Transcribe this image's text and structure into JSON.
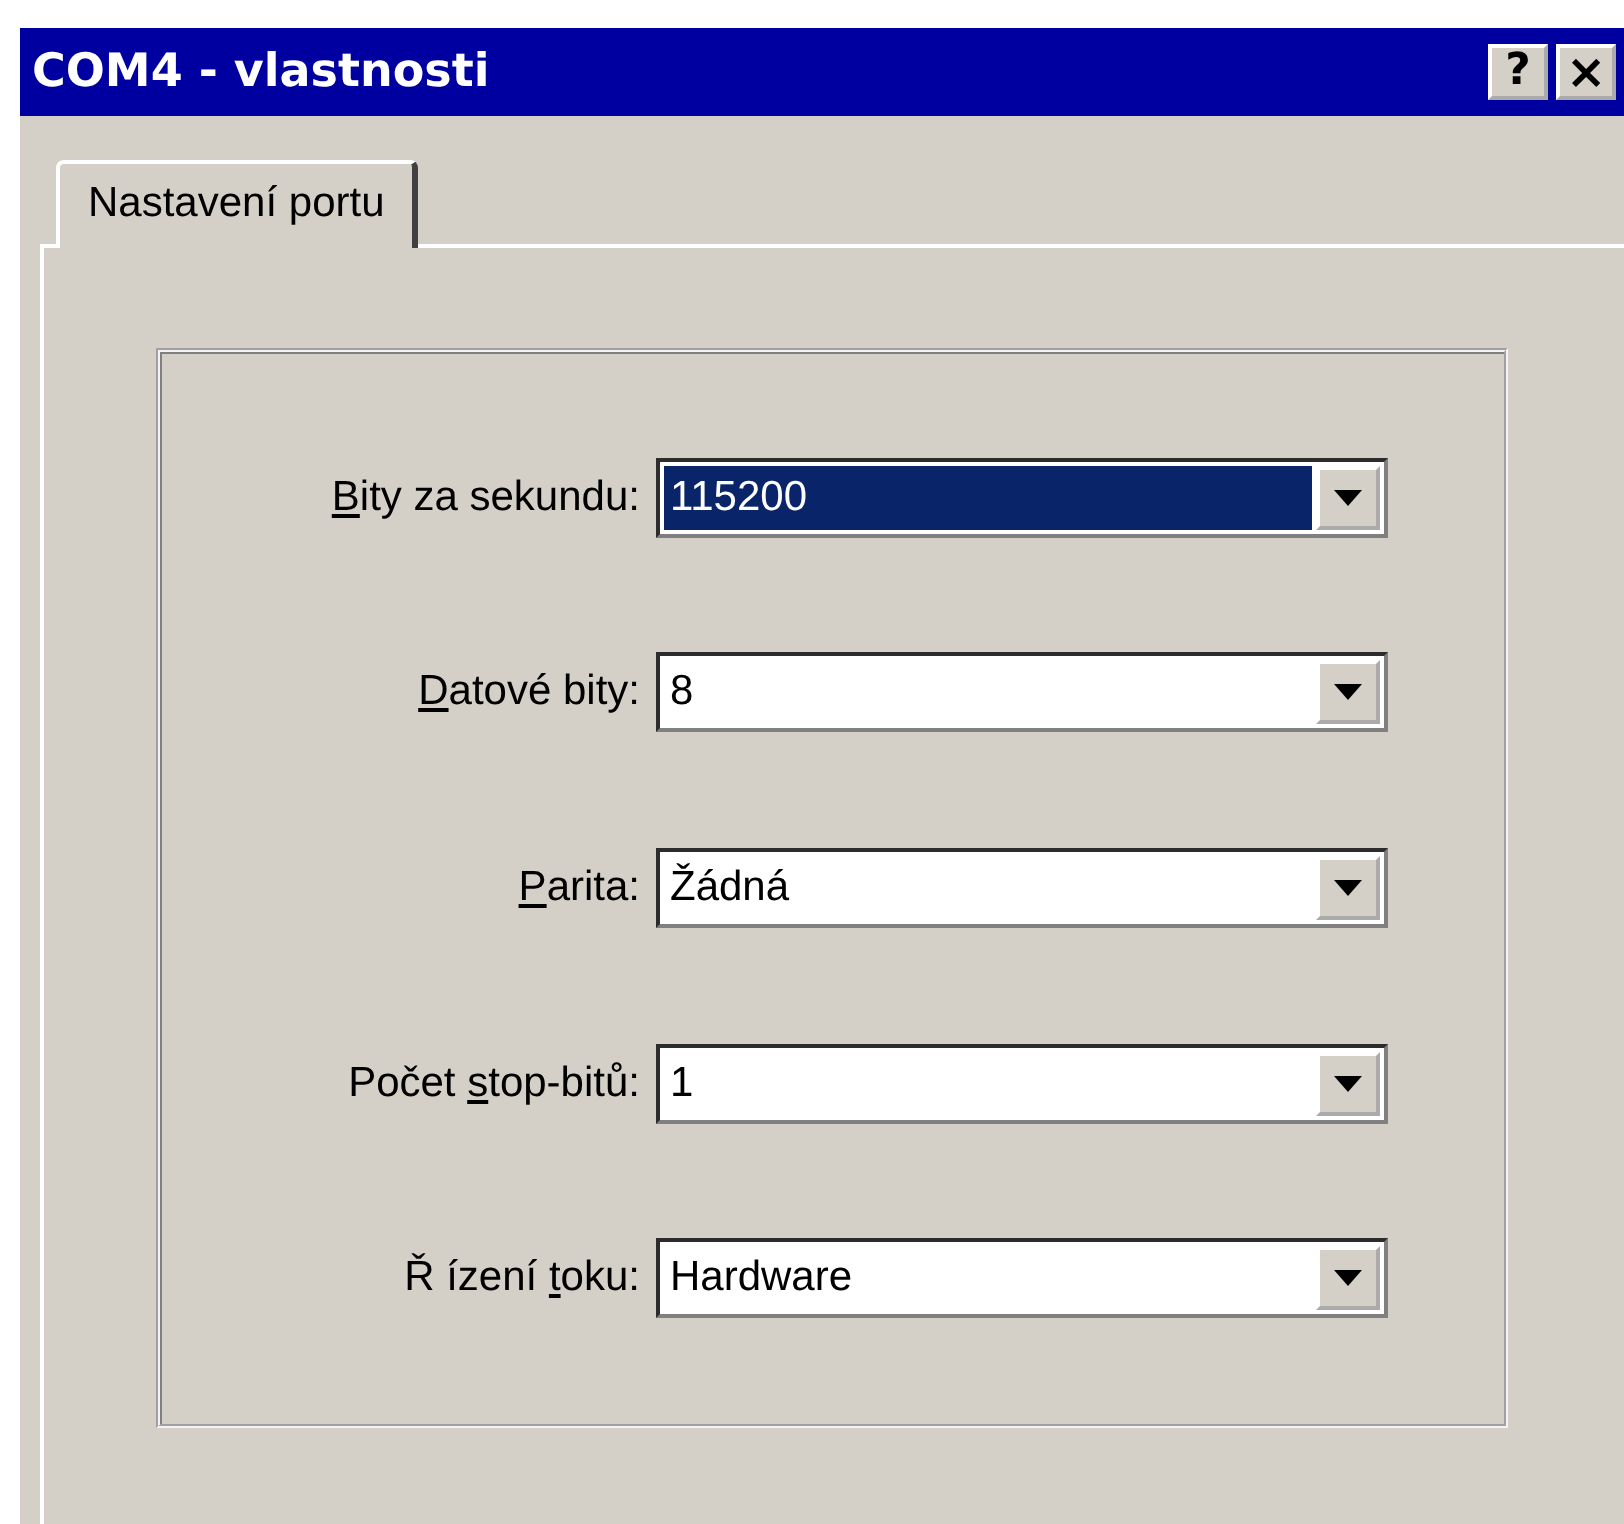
{
  "window": {
    "title": "COM4 - vlastnosti",
    "title_buttons": [
      {
        "kind": "help",
        "label": "?"
      },
      {
        "kind": "close",
        "label": "×"
      }
    ]
  },
  "tabs": [
    {
      "label": "Nastavení portu",
      "selected": true
    }
  ],
  "fields": [
    {
      "label": {
        "key": "B",
        "after": "ity za sekundu:"
      },
      "value": "115200",
      "selected": true
    },
    {
      "label": {
        "key": "D",
        "after": "atové bity:"
      },
      "value": "8",
      "selected": false
    },
    {
      "label": {
        "key": "P",
        "after": "arita:"
      },
      "value": "Žádná",
      "selected": false
    },
    {
      "label": {
        "before": "Počet ",
        "key": "s",
        "after": "top-bitů:"
      },
      "value": "1",
      "selected": false
    },
    {
      "label": {
        "before": "Ř ízení ",
        "key": "t",
        "after": "oku:"
      },
      "value": "Hardware",
      "selected": false
    }
  ]
}
